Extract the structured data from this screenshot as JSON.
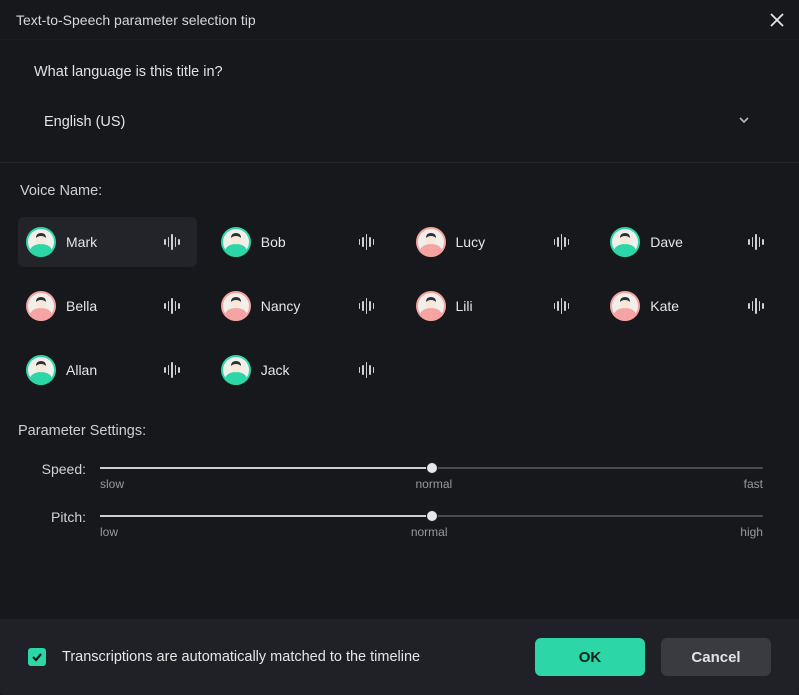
{
  "header": {
    "title": "Text-to-Speech parameter selection tip"
  },
  "language": {
    "question": "What language is this title in?",
    "value": "English (US)"
  },
  "voice": {
    "section_label": "Voice Name:",
    "items": [
      {
        "name": "Mark",
        "gender": "m",
        "selected": true
      },
      {
        "name": "Bob",
        "gender": "m",
        "selected": false
      },
      {
        "name": "Lucy",
        "gender": "f",
        "selected": false
      },
      {
        "name": "Dave",
        "gender": "m",
        "selected": false
      },
      {
        "name": "Bella",
        "gender": "f",
        "selected": false
      },
      {
        "name": "Nancy",
        "gender": "f",
        "selected": false
      },
      {
        "name": "Lili",
        "gender": "f",
        "selected": false
      },
      {
        "name": "Kate",
        "gender": "f",
        "selected": false
      },
      {
        "name": "Allan",
        "gender": "m",
        "selected": false
      },
      {
        "name": "Jack",
        "gender": "m",
        "selected": false
      }
    ]
  },
  "params": {
    "section_label": "Parameter Settings:",
    "speed": {
      "label": "Speed:",
      "value": 50,
      "low": "slow",
      "mid": "normal",
      "high": "fast"
    },
    "pitch": {
      "label": "Pitch:",
      "value": 50,
      "low": "low",
      "mid": "normal",
      "high": "high"
    }
  },
  "footer": {
    "checkbox_checked": true,
    "checkbox_label": "Transcriptions are automatically matched to the timeline",
    "ok": "OK",
    "cancel": "Cancel"
  },
  "colors": {
    "accent": "#2dd6a7",
    "male_avatar": "#2dd6a7",
    "female_avatar": "#f5a3a3"
  }
}
